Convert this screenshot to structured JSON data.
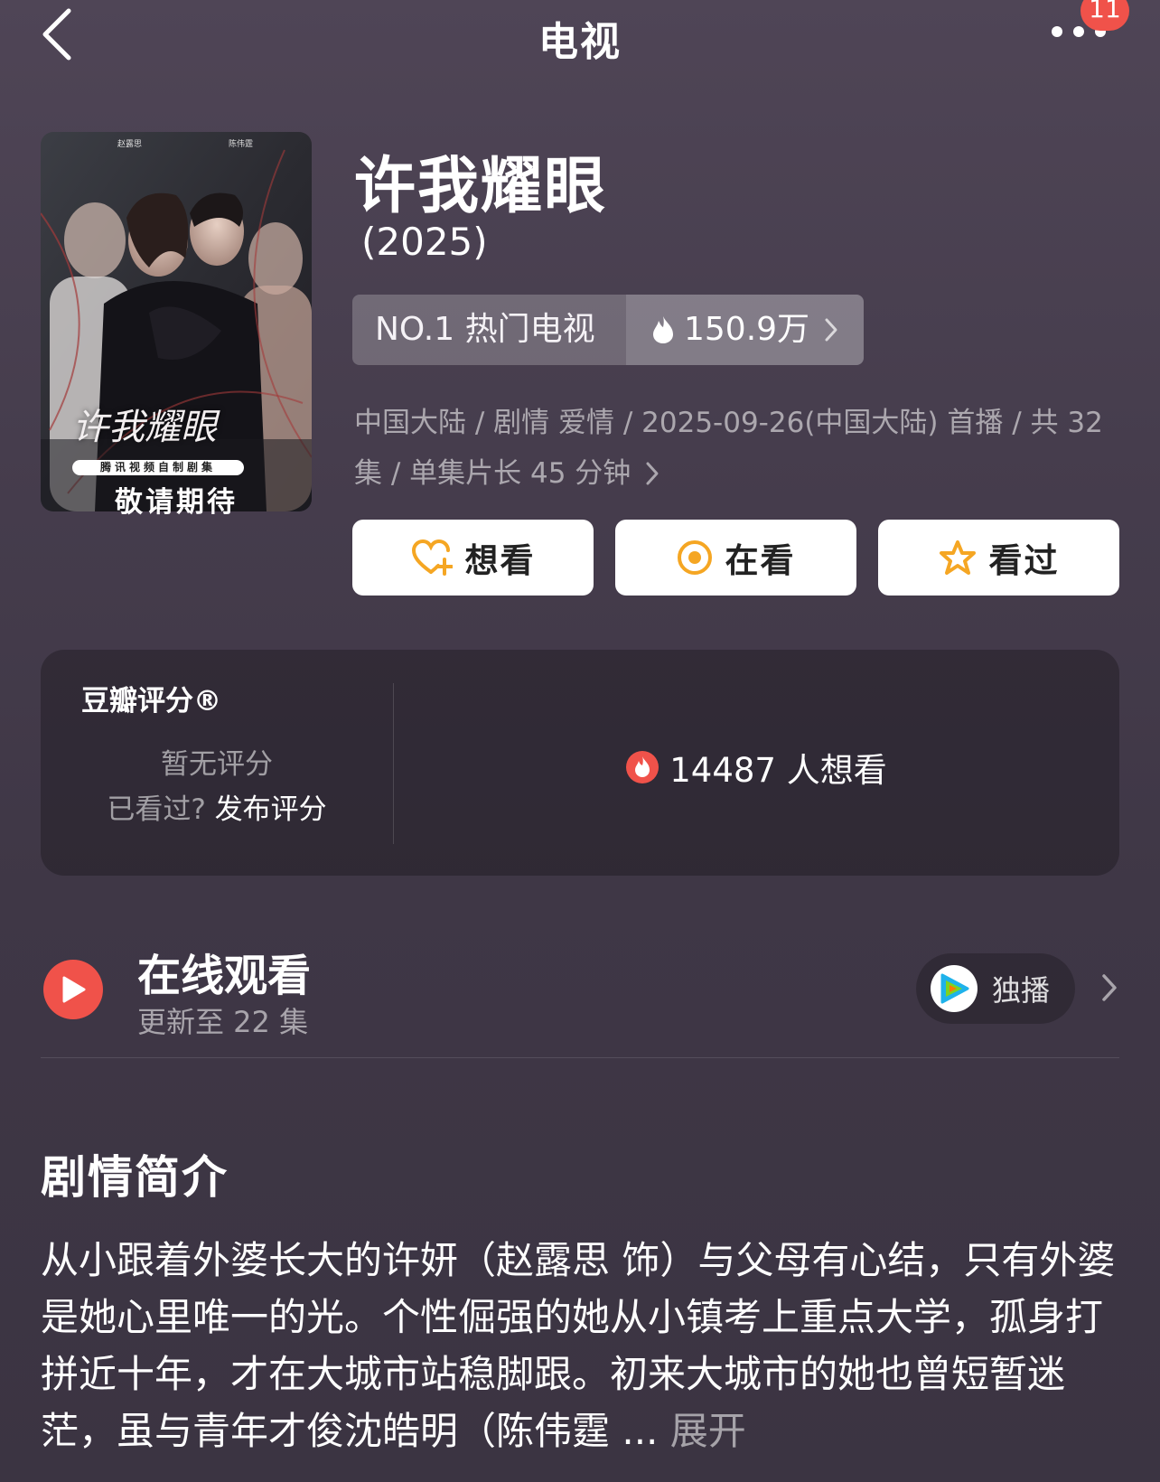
{
  "header": {
    "title": "电视",
    "notification_count": "11"
  },
  "poster": {
    "credits_left": "赵露思",
    "credits_right": "陈伟霆",
    "logo_text": "许我耀眼",
    "tag": "腾讯视频自制剧集",
    "cta": "敬请期待"
  },
  "show": {
    "title": "许我耀眼",
    "year": "(2025)",
    "rank_label": "NO.1 热门电视",
    "heat": "150.9万",
    "meta": "中国大陆 / 剧情 爱情 / 2025-09-26(中国大陆) 首播 / 共 32集 / 单集片长 45 分钟"
  },
  "actions": {
    "want": "想看",
    "watching": "在看",
    "watched": "看过"
  },
  "rating": {
    "title": "豆瓣评分®",
    "no_rating": "暂无评分",
    "prompt": "已看过?",
    "publish": "发布评分",
    "want_count": "14487 人想看"
  },
  "online": {
    "title": "在线观看",
    "subtitle": "更新至 22 集",
    "exclusive": "独播"
  },
  "synopsis": {
    "title": "剧情简介",
    "text": "从小跟着外婆长大的许妍（赵露思 饰）与父母有心结，只有外婆是她心里唯一的光。个性倔强的她从小镇考上重点大学，孤身打拼近十年，才在大城市站稳脚跟。初来大城市的她也曾短暂迷茫，虽与青年才俊沈皓明（陈伟霆 ...",
    "expand": "展开"
  },
  "colors": {
    "accent_red": "#f0524a",
    "star_orange": "#f5a623"
  }
}
